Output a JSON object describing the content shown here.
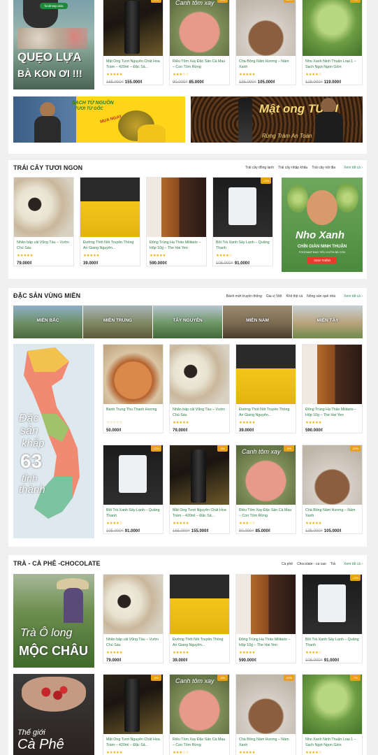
{
  "top_promo": {
    "fb_tag": "foodmap.asia",
    "quote_line1": "QUẸO LỰA",
    "quote_line2": "BÀ KON ƠI !!!",
    "durian_banner_line1": "SẠCH TỪ NGUỒN",
    "durian_banner_line2": "TƯƠI TỪ GỐC",
    "durian_banner_cta": "MUA NGAY",
    "honey_banner_title": "Mật ong TƯƠI",
    "honey_banner_sub": "Rừng Tràm An Toàn"
  },
  "top_products": [
    {
      "name": "Mật Ong Tươi Nguyên Chất Hoa Tràm – 420ml – Đặc Sả...",
      "old": "165.000₫",
      "now": "155.000₫",
      "badge": "-6%",
      "stars": "★★★★★",
      "img": "honey-bottle"
    },
    {
      "name": "Riêu Tôm Xay Đặc Sản Cà Mau – Con Tôm Rừng",
      "old": "90.000₫",
      "now": "85.000₫",
      "badge": "-6%",
      "stars": "★★★☆☆",
      "img": "shrimp-bowl",
      "overlay": "Canh tôm xay"
    },
    {
      "name": "Chà Bông Nấm Hương – Nấm Xanh",
      "old": "135.000₫",
      "now": "105.000₫",
      "badge": "-22%",
      "stars": "★★★★★",
      "img": "floss"
    },
    {
      "name": "Nho Xanh Ninh Thuận Loại 1 – Sạch Ngọt Ngon Giòn",
      "old": "128.000₫",
      "now": "119.000₫",
      "badge": "-7%",
      "stars": "★★★★☆",
      "img": "grapes"
    }
  ],
  "fruit": {
    "title": "TRÁI CÂY TƯƠI NGON",
    "tabs": [
      "Trái cây đông lạnh",
      "Trái cây nhập khẩu",
      "Trái cây nội địa"
    ],
    "see_all": "Xem tất cả ›",
    "products": [
      {
        "name": "Nhãn bấp cải Vũng Tàu – Vườn Chú Sáu",
        "old": "",
        "now": "79.000₫",
        "badge": "",
        "stars": "★★★★★",
        "img": "longan"
      },
      {
        "name": "Đường Thốt Nốt Truyền Thống An Giang Nguyên...",
        "old": "",
        "now": "39.000₫",
        "badge": "",
        "stars": "★★★★★",
        "img": "palm-sugar"
      },
      {
        "name": "Đông Trùng Hạ Thảo Militaris – Hộp 10g – The Hai Yen",
        "old": "",
        "now": "590.000₫",
        "badge": "",
        "stars": "★★★★★",
        "img": "cordyceps"
      },
      {
        "name": "Bột Trà Xanh Sấy Lạnh – Quảng Thanh",
        "old": "105.000₫",
        "now": "91.000₫",
        "badge": "-13%",
        "stars": "★★★★☆",
        "img": "green-tea"
      }
    ],
    "banner_title": "Nho Xanh",
    "banner_sub": "CHÍN GIÀN NINH THUẬN",
    "banner_sub2": "FOODMAP BAO TIÊU VƯỜN BÀ CON",
    "banner_btn": "XEM THÊM"
  },
  "regional": {
    "title": "ĐẶC SẢN VÙNG MIỀN",
    "tabs": [
      "Bánh mứt truyền thống",
      "Gia vị Việt",
      "Khô thịt cá",
      "Nông sản quê nhà"
    ],
    "see_all": "Xem tất cả ›",
    "regions": [
      "MIỀN BẮC",
      "MIỀN TRUNG",
      "TÂY NGUYÊN",
      "MIỀN NAM",
      "MIỀN TÂY"
    ],
    "map_text1": "Đặc",
    "map_text2": "sản",
    "map_text3": "khắp",
    "map_text4": "63",
    "map_text5": "tỉnh",
    "map_text6": "thành",
    "products": [
      {
        "name": "Bánh Trung Thu Thanh Hương",
        "old": "",
        "now": "50.000₫",
        "badge": "",
        "stars": "☆☆☆☆☆",
        "img": "mooncake"
      },
      {
        "name": "Nhãn bấp cải Vũng Tàu – Vườn Chú Sáu",
        "old": "",
        "now": "79.000₫",
        "badge": "",
        "stars": "★★★★★",
        "img": "longan"
      },
      {
        "name": "Đường Thốt Nốt Truyền Thống An Giang Nguyên...",
        "old": "",
        "now": "39.000₫",
        "badge": "",
        "stars": "★★★★★",
        "img": "palm-sugar"
      },
      {
        "name": "Đông Trùng Hạ Thảo Militaris – Hộp 10g – The Hai Yen",
        "old": "",
        "now": "590.000₫",
        "badge": "",
        "stars": "★★★★★",
        "img": "cordyceps"
      },
      {
        "name": "Bột Trà Xanh Sấy Lạnh – Quảng Thanh",
        "old": "105.000₫",
        "now": "91.000₫",
        "badge": "-13%",
        "stars": "★★★★☆",
        "img": "green-tea"
      },
      {
        "name": "Mật Ong Tươi Nguyên Chất Hoa Tràm – 420ml – Đặc Sả...",
        "old": "165.000₫",
        "now": "155.000₫",
        "badge": "-6%",
        "stars": "★★★★★",
        "img": "honey-bottle"
      },
      {
        "name": "Riêu Tôm Xay Đặc Sản Cà Mau – Con Tôm Rừng",
        "old": "90.000₫",
        "now": "85.000₫",
        "badge": "-6%",
        "stars": "★★★☆☆",
        "img": "shrimp-bowl",
        "overlay": "Canh tôm xay"
      },
      {
        "name": "Chà Bông Nấm Hương – Nấm Xanh",
        "old": "135.000₫",
        "now": "105.000₫",
        "badge": "-22%",
        "stars": "★★★★★",
        "img": "floss"
      }
    ]
  },
  "tea": {
    "title": "TRÀ - CÀ PHÊ -CHOCOLATE",
    "tabs": [
      "Cà phê",
      "Chocolate - ca cao",
      "Trà"
    ],
    "see_all": "Xem tất cả ›",
    "banner1_line1": "Trà Ô long",
    "banner1_line2": "MỘC CHÂU",
    "banner2_line1": "Thế giới",
    "banner2_line2": "Cà Phê",
    "products": [
      {
        "name": "Nhãn bấp cải Vũng Tàu – Vườn Chú Sáu",
        "old": "",
        "now": "79.000₫",
        "badge": "",
        "stars": "★★★★★",
        "img": "longan"
      },
      {
        "name": "Đường Thốt Nốt Truyền Thống An Giang Nguyên...",
        "old": "",
        "now": "39.000₫",
        "badge": "",
        "stars": "★★★★★",
        "img": "palm-sugar"
      },
      {
        "name": "Đông Trùng Hạ Thảo Militaris – Hộp 10g – The Hai Yen",
        "old": "",
        "now": "590.000₫",
        "badge": "",
        "stars": "★★★★★",
        "img": "cordyceps"
      },
      {
        "name": "Bột Trà Xanh Sấy Lạnh – Quảng Thanh",
        "old": "105.000₫",
        "now": "91.000₫",
        "badge": "-13%",
        "stars": "★★★★☆",
        "img": "green-tea"
      },
      {
        "name": "Mật Ong Tươi Nguyên Chất Hoa Tràm – 420ml – Đặc Sả...",
        "old": "",
        "now": "",
        "badge": "-6%",
        "stars": "★★★★★",
        "img": "honey-bottle"
      },
      {
        "name": "Riêu Tôm Xay Đặc Sản Cà Mau – Con Tôm Rừng",
        "old": "",
        "now": "",
        "badge": "-6%",
        "stars": "★★★☆☆",
        "img": "shrimp-bowl",
        "overlay": "Canh tôm xay"
      },
      {
        "name": "Chà Bông Nấm Hương – Nấm Xanh",
        "old": "",
        "now": "",
        "badge": "-22%",
        "stars": "★★★★★",
        "img": "floss"
      },
      {
        "name": "Nho Xanh Ninh Thuận Loại 1 – Sạch Ngọt Ngon Giòn",
        "old": "",
        "now": "",
        "badge": "-7%",
        "stars": "★★★★☆",
        "img": "grapes"
      }
    ]
  },
  "colors": {
    "accent": "#2e8b57",
    "price": "#222222",
    "star": "#e8b10c",
    "badge": "#e8a215"
  }
}
